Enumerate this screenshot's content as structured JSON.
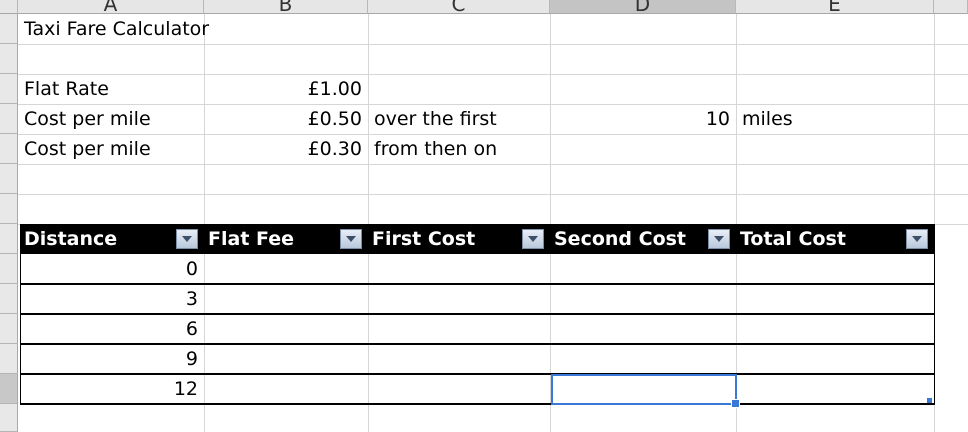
{
  "columns": [
    "A",
    "B",
    "C",
    "D",
    "E"
  ],
  "title": "Taxi Fare Calculator",
  "rates": [
    {
      "label": "Flat Rate",
      "value": "£1.00",
      "note": "",
      "threshold": "",
      "unit": ""
    },
    {
      "label": "Cost per mile",
      "value": "£0.50",
      "note": "over the first",
      "threshold": "10",
      "unit": "miles"
    },
    {
      "label": "Cost per mile",
      "value": "£0.30",
      "note": "from then on",
      "threshold": "",
      "unit": ""
    }
  ],
  "table": {
    "headers": [
      "Distance",
      "Flat Fee",
      "First Cost",
      "Second Cost",
      "Total Cost"
    ],
    "distances": [
      "0",
      "3",
      "6",
      "9",
      "12"
    ]
  },
  "colors": {
    "header_bg": "#000000",
    "selection": "#3a78d8"
  }
}
